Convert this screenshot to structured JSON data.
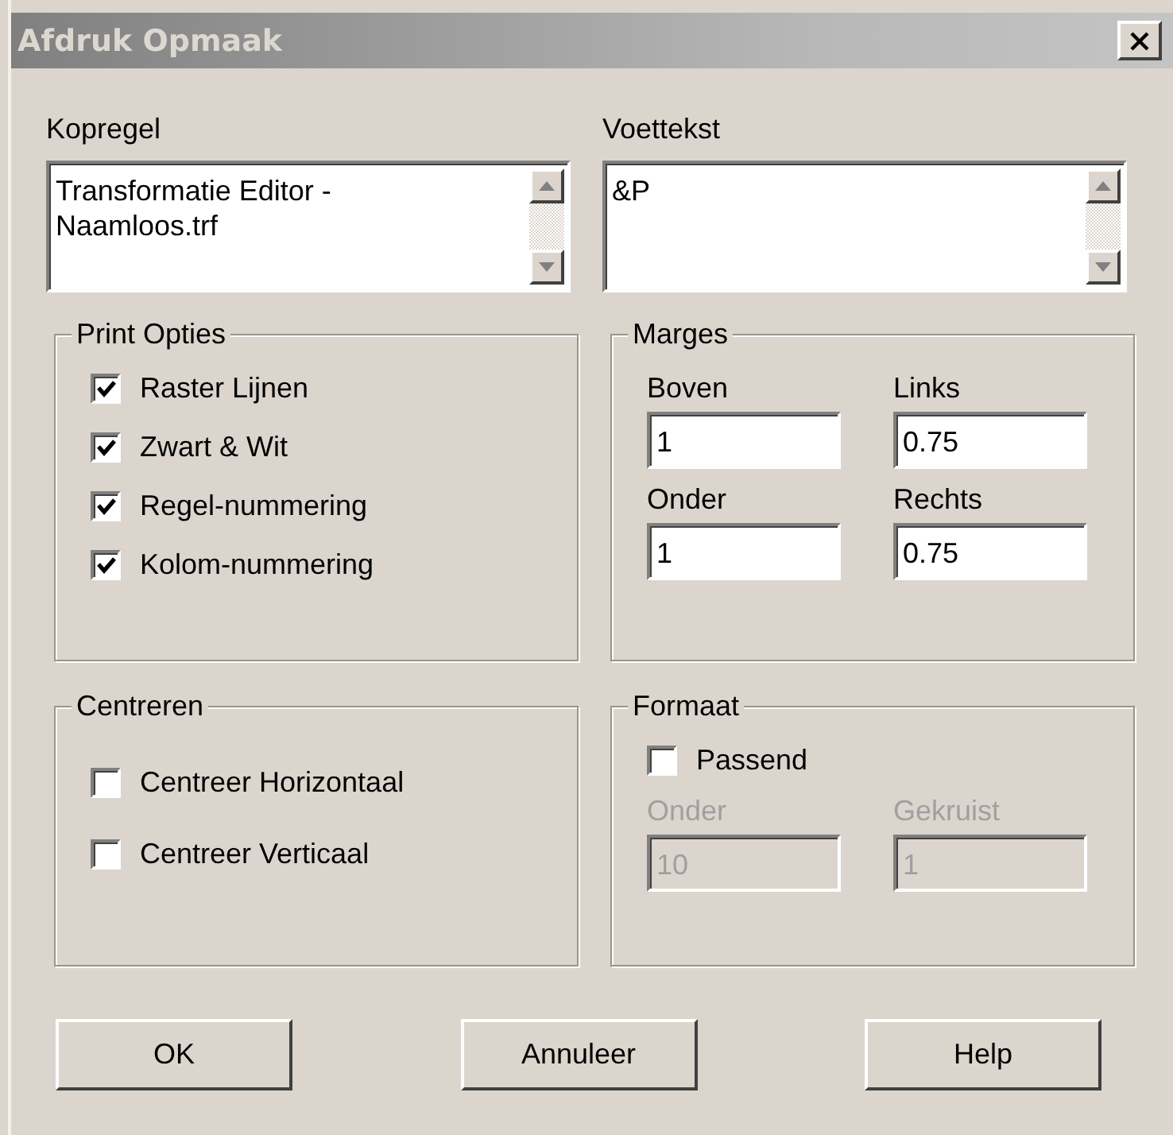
{
  "window": {
    "title": "Afdruk Opmaak"
  },
  "text_boxes": [
    {
      "label": "Kopregel",
      "value": "Transformatie Editor - Naamloos.trf"
    },
    {
      "label": "Voettekst",
      "value": "&P"
    }
  ],
  "groups": [
    {
      "kind": "checks",
      "title": "Print Opties",
      "options": [
        {
          "label": "Raster Lijnen",
          "checked": true
        },
        {
          "label": "Zwart & Wit",
          "checked": true
        },
        {
          "label": "Regel-nummering",
          "checked": true
        },
        {
          "label": "Kolom-nummering",
          "checked": true
        }
      ]
    },
    {
      "kind": "fields",
      "title": "Marges",
      "fields": [
        {
          "label": "Boven",
          "value": "1",
          "disabled": false
        },
        {
          "label": "Links",
          "value": "0.75",
          "disabled": false
        },
        {
          "label": "Onder",
          "value": "1",
          "disabled": false
        },
        {
          "label": "Rechts",
          "value": "0.75",
          "disabled": false
        }
      ]
    },
    {
      "kind": "checks",
      "title": "Centreren",
      "options": [
        {
          "label": "Centreer Horizontaal",
          "checked": false
        },
        {
          "label": "Centreer Verticaal",
          "checked": false
        }
      ]
    },
    {
      "kind": "mixed",
      "title": "Formaat",
      "options": [
        {
          "label": "Passend",
          "checked": false
        }
      ],
      "fields": [
        {
          "label": "Onder",
          "value": "10",
          "disabled": true
        },
        {
          "label": "Gekruist",
          "value": "1",
          "disabled": true
        }
      ]
    }
  ],
  "buttons": [
    {
      "label": "OK"
    },
    {
      "label": "Annuleer"
    },
    {
      "label": "Help"
    }
  ]
}
